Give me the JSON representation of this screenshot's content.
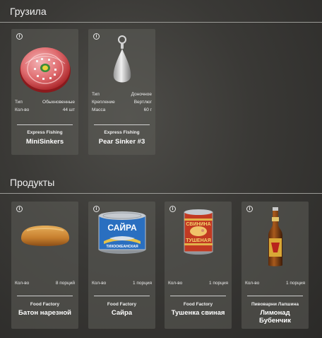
{
  "sections": {
    "sinkers": {
      "title": "Грузила"
    },
    "products": {
      "title": "Продукты"
    }
  },
  "sinkers": [
    {
      "icon": "red-mini-sinkers-box-icon",
      "stats": [
        {
          "label": "Тип",
          "value": "Обыкновенные"
        },
        {
          "label": "Кол-во",
          "value": "44 шт"
        }
      ],
      "brand": "Express Fishing",
      "name": "MiniSinkers"
    },
    {
      "icon": "pear-sinker-icon",
      "stats": [
        {
          "label": "Тип",
          "value": "Доночное"
        },
        {
          "label": "Крепление",
          "value": "Вертлюг"
        },
        {
          "label": "Масса",
          "value": "60 г"
        }
      ],
      "brand": "Express Fishing",
      "name": "Pear Sinker #3"
    }
  ],
  "products": [
    {
      "icon": "bread-loaf-icon",
      "stats": [
        {
          "label": "Кол-во",
          "value": "8 порций"
        }
      ],
      "brand": "Food Factory",
      "name": "Батон нарезной"
    },
    {
      "icon": "saury-can-icon",
      "can_text": "САЙРА",
      "can_subtext": "ТИХООКЕАНСКАЯ",
      "stats": [
        {
          "label": "Кол-во",
          "value": "1 порция"
        }
      ],
      "brand": "Food Factory",
      "name": "Сайра"
    },
    {
      "icon": "stewed-pork-can-icon",
      "can_text": "СВИНИНА",
      "can_subtext": "ТУШЕНАЯ",
      "stats": [
        {
          "label": "Кол-во",
          "value": "1 порция"
        }
      ],
      "brand": "Food Factory",
      "name": "Тушенка свиная"
    },
    {
      "icon": "lemonade-bottle-icon",
      "stats": [
        {
          "label": "Кол-во",
          "value": "1 порция"
        }
      ],
      "brand": "Пивоварни Лапшина",
      "name_line1": "Лимонад",
      "name_line2": "Бубенчик"
    }
  ],
  "colors": {
    "card_bg": "#5c5c58",
    "sinker_red": "#c8373a",
    "can_blue": "#2a6fc0",
    "can_red": "#c23a22"
  }
}
